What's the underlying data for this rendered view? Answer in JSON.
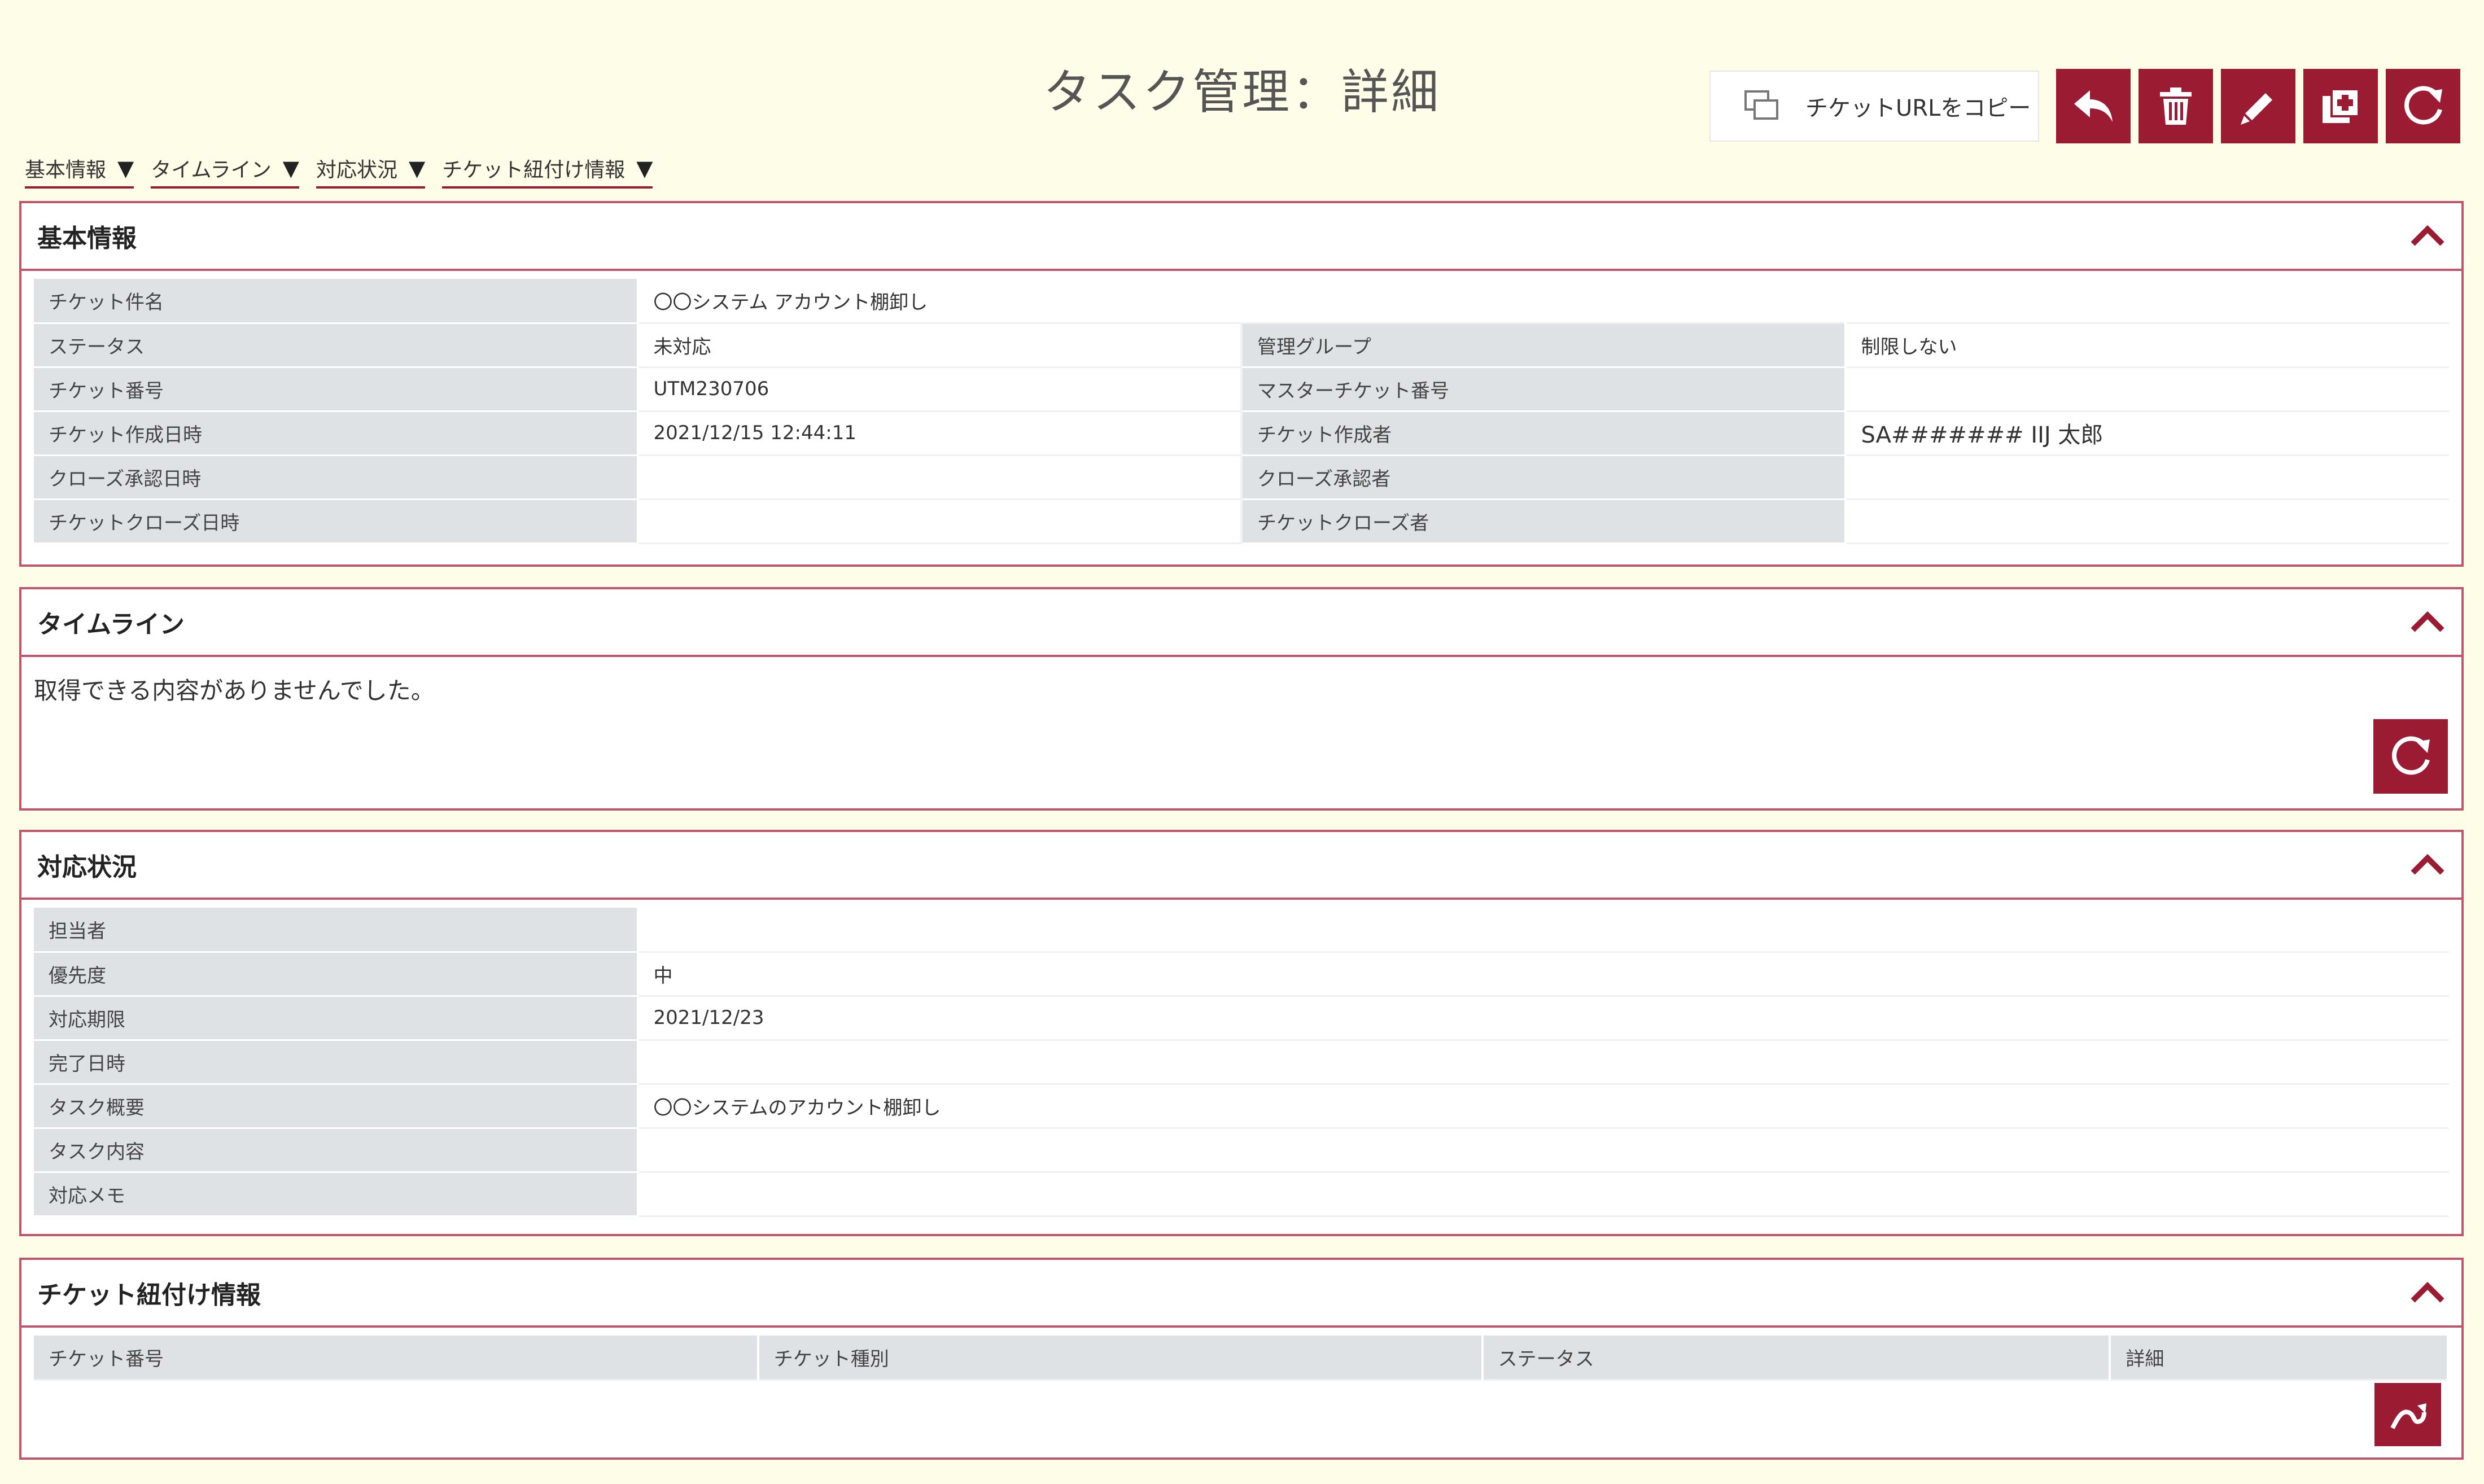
{
  "header": {
    "title": "タスク管理：詳細",
    "copy_url_label": "チケットURLをコピー",
    "buttons": [
      "back-icon",
      "trash-icon",
      "edit-icon",
      "duplicate-icon",
      "refresh-icon"
    ],
    "accent_color": "#9b1b32"
  },
  "anchors": [
    {
      "label": "基本情報",
      "arrow": "▼"
    },
    {
      "label": "タイムライン",
      "arrow": "▼"
    },
    {
      "label": "対応状況",
      "arrow": "▼"
    },
    {
      "label": "チケット紐付け情報",
      "arrow": "▼"
    }
  ],
  "basic": {
    "title": "基本情報",
    "collapse_icon": "chevron-up-icon",
    "rows": [
      {
        "l1": "チケット件名",
        "v1": "〇〇システム アカウント棚卸し"
      },
      {
        "l1": "ステータス",
        "v1": "未対応",
        "l2": "管理グループ",
        "v2": "制限しない"
      },
      {
        "l1": "チケット番号",
        "v1": "UTM230706",
        "l2": "マスターチケット番号",
        "v2": ""
      },
      {
        "l1": "チケット作成日時",
        "v1": "2021/12/15 12:44:11",
        "l2": "チケット作成者",
        "v2": "SA####### IIJ 太郎"
      },
      {
        "l1": "クローズ承認日時",
        "v1": "",
        "l2": "クローズ承認者",
        "v2": ""
      },
      {
        "l1": "チケットクローズ日時",
        "v1": "",
        "l2": "チケットクローズ者",
        "v2": ""
      }
    ]
  },
  "timeline": {
    "title": "タイムライン",
    "empty_message": "取得できる内容がありませんでした。"
  },
  "status": {
    "title": "対応状況",
    "rows": [
      {
        "label": "担当者",
        "value": ""
      },
      {
        "label": "優先度",
        "value": "中"
      },
      {
        "label": "対応期限",
        "value": "2021/12/23"
      },
      {
        "label": "完了日時",
        "value": ""
      },
      {
        "label": "タスク概要",
        "value": "〇〇システムのアカウント棚卸し"
      },
      {
        "label": "タスク内容",
        "value": ""
      },
      {
        "label": "対応メモ",
        "value": ""
      }
    ]
  },
  "relations": {
    "title": "チケット紐付け情報",
    "columns": [
      "チケット番号",
      "チケット種別",
      "ステータス",
      "詳細"
    ]
  }
}
